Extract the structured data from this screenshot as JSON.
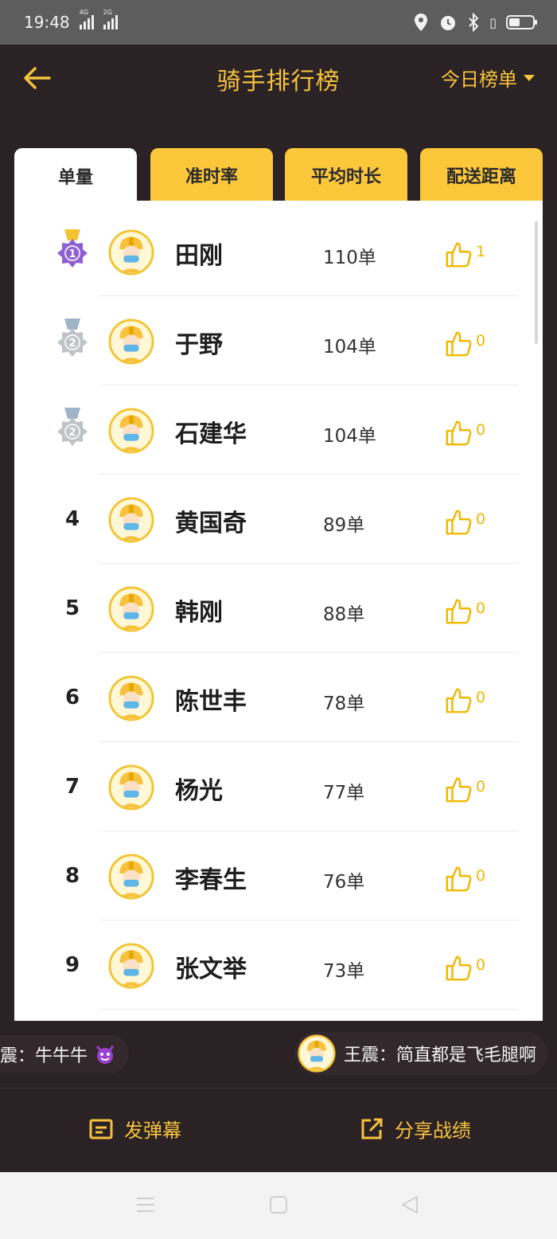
{
  "status": {
    "time": "19:48",
    "sig1_tag": "4G",
    "sig2_tag": "2G"
  },
  "header": {
    "title": "骑手排行榜",
    "filter_label": "今日榜单"
  },
  "tabs": [
    {
      "label": "单量",
      "active": true
    },
    {
      "label": "准时率",
      "active": false
    },
    {
      "label": "平均时长",
      "active": false
    },
    {
      "label": "配送距离",
      "active": false
    }
  ],
  "rows": [
    {
      "rank": "1",
      "medal": "purple",
      "name": "田刚",
      "count": "110单",
      "likes": "1"
    },
    {
      "rank": "2",
      "medal": "silver",
      "name": "于野",
      "count": "104单",
      "likes": "0"
    },
    {
      "rank": "2",
      "medal": "silver",
      "name": "石建华",
      "count": "104单",
      "likes": "0"
    },
    {
      "rank": "4",
      "medal": "",
      "name": "黄国奇",
      "count": "89单",
      "likes": "0"
    },
    {
      "rank": "5",
      "medal": "",
      "name": "韩刚",
      "count": "88单",
      "likes": "0"
    },
    {
      "rank": "6",
      "medal": "",
      "name": "陈世丰",
      "count": "78单",
      "likes": "0"
    },
    {
      "rank": "7",
      "medal": "",
      "name": "杨光",
      "count": "77单",
      "likes": "0"
    },
    {
      "rank": "8",
      "medal": "",
      "name": "李春生",
      "count": "76单",
      "likes": "0"
    },
    {
      "rank": "9",
      "medal": "",
      "name": "张文举",
      "count": "73单",
      "likes": "0"
    }
  ],
  "danmu": {
    "left": "震：牛牛牛",
    "left_icon": "devil-emoji-icon",
    "right": "王震：简直都是飞毛腿啊"
  },
  "actions": {
    "danmu_label": "发弹幕",
    "share_label": "分享战绩"
  },
  "colors": {
    "accent": "#f6c23e",
    "tab_bg": "#fcc73b",
    "background": "#2a2224",
    "medal_purple": "#8e5fd0",
    "medal_silver": "#bfc3c8"
  }
}
